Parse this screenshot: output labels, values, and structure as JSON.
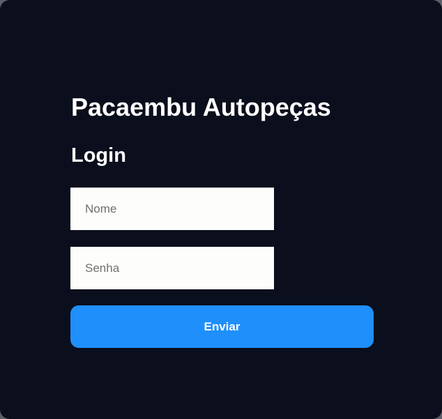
{
  "app": {
    "title": "Pacaembu Autopeças"
  },
  "login": {
    "heading": "Login",
    "name_field": {
      "value": "",
      "placeholder": "Nome"
    },
    "password_field": {
      "value": "",
      "placeholder": "Senha"
    },
    "submit_label": "Enviar"
  },
  "colors": {
    "background": "#0b0e1c",
    "accent": "#1e8ffb",
    "input_background": "#fdfdfb",
    "text": "#ffffff"
  }
}
